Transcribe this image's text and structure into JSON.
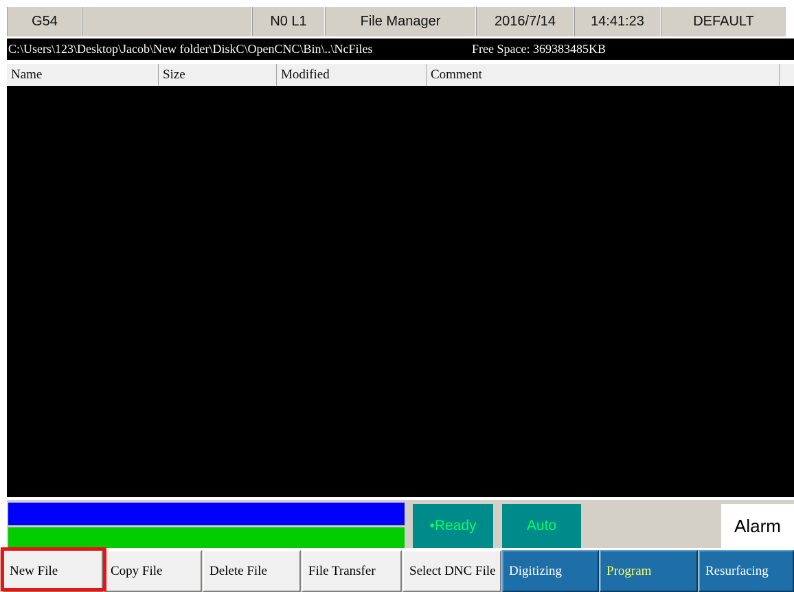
{
  "topbar": {
    "coord_system": "G54",
    "line": "N0 L1",
    "screen_title": "File Manager",
    "date": "2016/7/14",
    "time": "14:41:23",
    "profile": "DEFAULT"
  },
  "pathbar": {
    "path": "C:\\Users\\123\\Desktop\\Jacob\\New folder\\DiskC\\OpenCNC\\Bin\\..\\NcFiles",
    "free_space": "Free Space: 369383485KB"
  },
  "file_list": {
    "columns": [
      "Name",
      "Size",
      "Modified",
      "Comment"
    ],
    "rows": []
  },
  "status": {
    "ready": "•Ready",
    "mode": "Auto",
    "alarm": "Alarm"
  },
  "softkeys": [
    {
      "label": "New File",
      "style": "gray",
      "highlighted": true
    },
    {
      "label": "Copy File",
      "style": "gray"
    },
    {
      "label": "Delete File",
      "style": "gray"
    },
    {
      "label": "File Transfer",
      "style": "gray"
    },
    {
      "label": "Select DNC File",
      "style": "gray"
    },
    {
      "label": "Digitizing",
      "style": "blue"
    },
    {
      "label": "Program",
      "style": "blue",
      "text_color": "#ffff66"
    },
    {
      "label": "Resurfacing",
      "style": "blue"
    }
  ],
  "colors": {
    "progress_blue": "#0000ff",
    "progress_green": "#00cc00",
    "status_teal": "#008b8b",
    "status_text": "#00ff66",
    "softkey_blue": "#1e6fa8",
    "highlight_frame": "#ee1111"
  }
}
